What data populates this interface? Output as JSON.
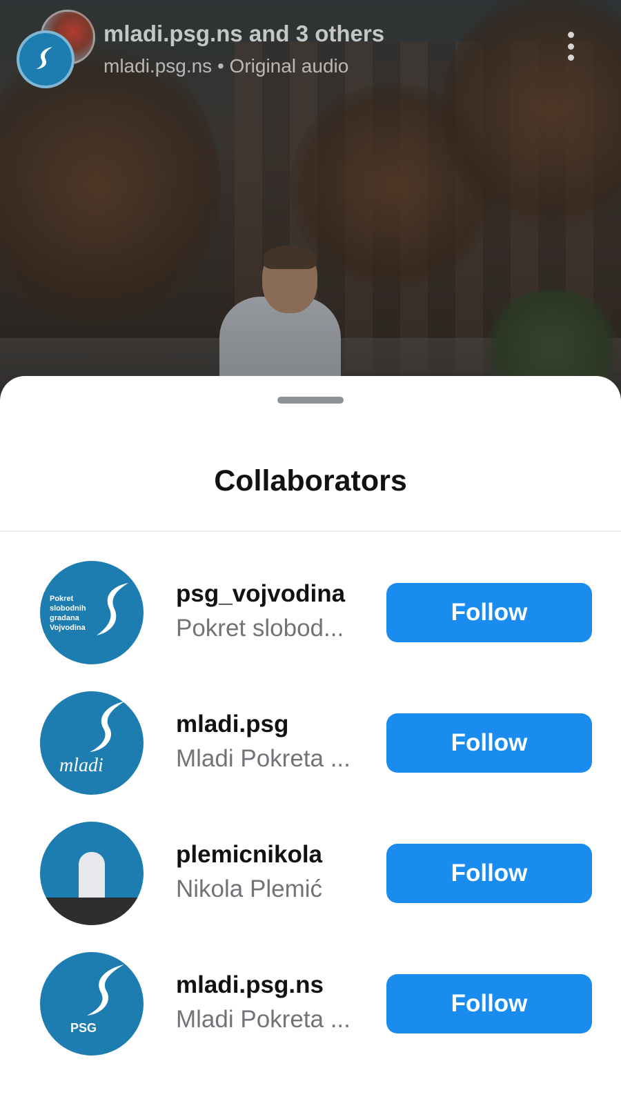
{
  "header": {
    "title": "mladi.psg.ns and 3 others",
    "subtitle": "mladi.psg.ns • Original audio",
    "more_icon": "more-vertical-icon"
  },
  "sheet": {
    "title": "Collaborators"
  },
  "collaborators": [
    {
      "username": "psg_vojvodina",
      "name": "Pokret slobod...",
      "button": "Follow",
      "avatar_text": "Pokret\nslobodnih\ngradana\nVojvodina"
    },
    {
      "username": "mladi.psg",
      "name": "Mladi Pokreta ...",
      "button": "Follow",
      "avatar_text": "mladi"
    },
    {
      "username": "plemicnikola",
      "name": "Nikola Plemić",
      "button": "Follow"
    },
    {
      "username": "mladi.psg.ns",
      "name": "Mladi Pokreta ...",
      "button": "Follow",
      "avatar_text": "PSG"
    }
  ],
  "colors": {
    "follow_button": "#1a8cf0",
    "brand_blue": "#1d7db0"
  }
}
